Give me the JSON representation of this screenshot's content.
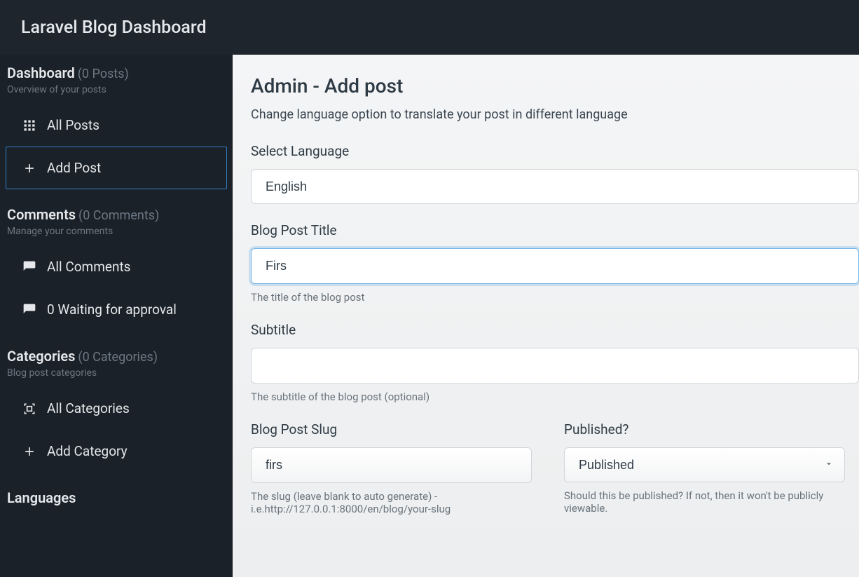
{
  "app": {
    "title": "Laravel Blog Dashboard"
  },
  "sidebar": {
    "dashboard": {
      "title": "Dashboard",
      "count": "(0 Posts)",
      "subtitle": "Overview of your posts",
      "items": [
        {
          "label": "All Posts"
        },
        {
          "label": "Add Post"
        }
      ]
    },
    "comments": {
      "title": "Comments",
      "count": "(0 Comments)",
      "subtitle": "Manage your comments",
      "items": [
        {
          "label": "All Comments"
        },
        {
          "label": "0 Waiting for approval"
        }
      ]
    },
    "categories": {
      "title": "Categories",
      "count": "(0 Categories)",
      "subtitle": "Blog post categories",
      "items": [
        {
          "label": "All Categories"
        },
        {
          "label": "Add Category"
        }
      ]
    },
    "languages": {
      "title": "Languages"
    }
  },
  "page": {
    "title": "Admin - Add post",
    "subtitle": "Change language option to translate your post in different language"
  },
  "form": {
    "language": {
      "label": "Select Language",
      "value": "English"
    },
    "title": {
      "label": "Blog Post Title",
      "value": "Firs",
      "help": "The title of the blog post"
    },
    "subtitle": {
      "label": "Subtitle",
      "value": "",
      "help": "The subtitle of the blog post (optional)"
    },
    "slug": {
      "label": "Blog Post Slug",
      "value": "firs",
      "help": "The slug (leave blank to auto generate) - i.e.http://127.0.0.1:8000/en/blog/your-slug"
    },
    "published": {
      "label": "Published?",
      "value": "Published",
      "help": "Should this be published? If not, then it won't be publicly viewable."
    }
  }
}
